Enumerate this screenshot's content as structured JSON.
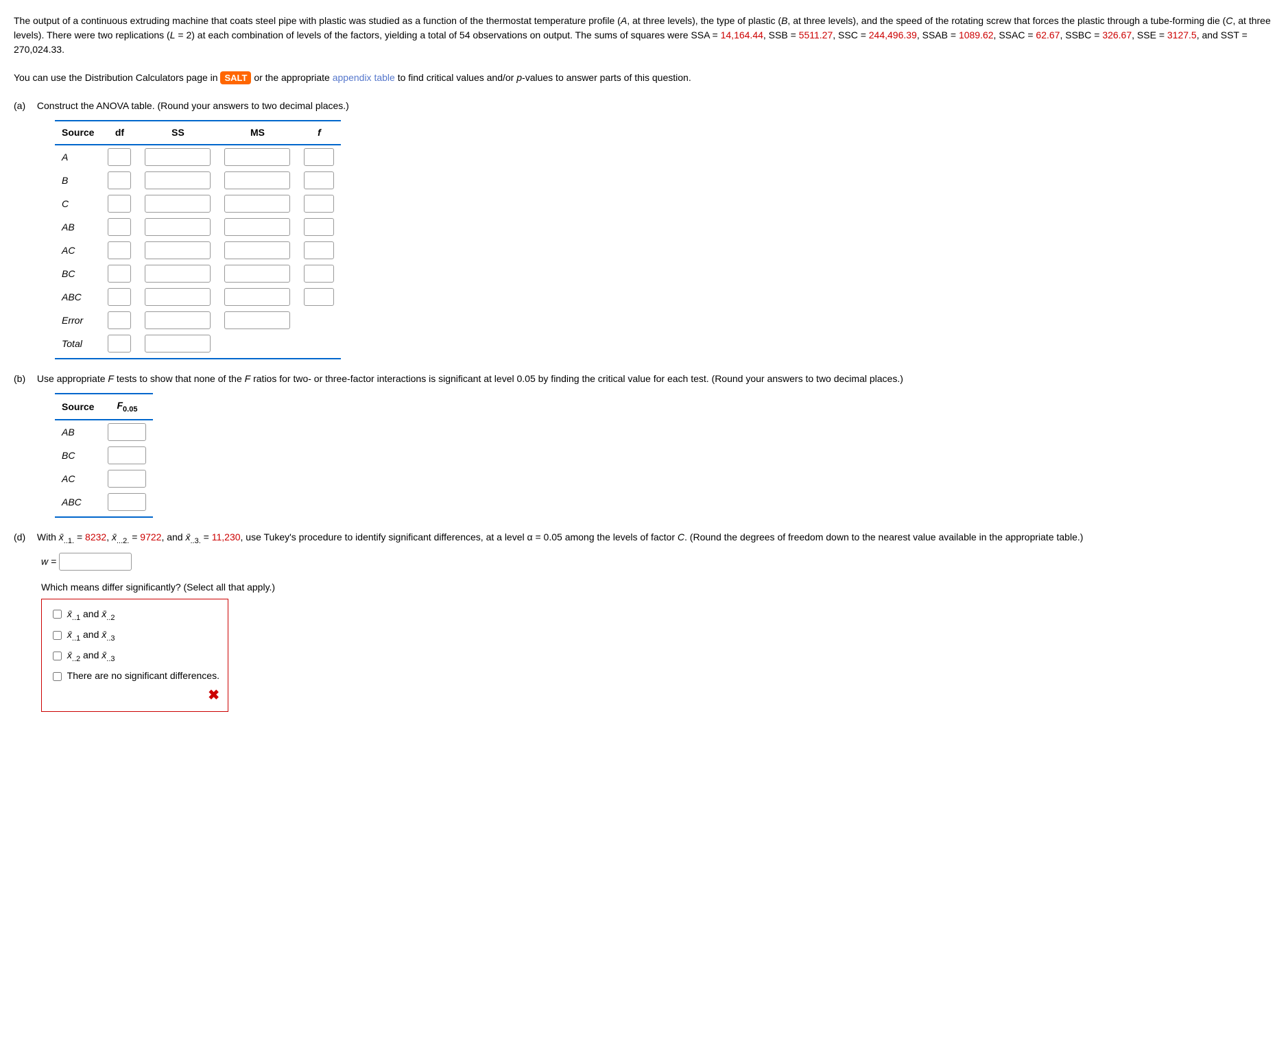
{
  "problem": {
    "p1_a": "The output of a continuous extruding machine that coats steel pipe with plastic was studied as a function of the thermostat temperature profile (",
    "p1_A": "A",
    "p1_b": ", at three levels), the type of plastic (",
    "p1_B": "B",
    "p1_c": ", at three levels), and the speed of the rotating screw that forces the plastic through a tube-forming die (",
    "p1_C": "C",
    "p1_d": ", at three levels). There were two replications (",
    "p1_L": "L",
    "p1_e": " = 2) at each combination of levels of the factors, yielding a total of 54 observations on output. The sums of squares were SSA = ",
    "ssa": "14,164.44",
    "p1_f": ", SSB = ",
    "ssb": "5511.27",
    "p1_g": ", SSC = ",
    "ssc": "244,496.39",
    "p1_h": ", SSAB = ",
    "ssab": "1089.62",
    "p1_i": ", SSAC = ",
    "ssac": "62.67",
    "p1_j": ", SSBC = ",
    "ssbc": "326.67",
    "p1_k": ", SSE = ",
    "sse": "3127.5",
    "p1_l": ", and SST = 270,024.33."
  },
  "salt_line": {
    "pre": "You can use the Distribution Calculators page in ",
    "salt": "SALT",
    "mid": " or the appropriate ",
    "link": "appendix table",
    "post": " to find critical values and/or ",
    "p": "p",
    "post2": "-values to answer parts of this question."
  },
  "partA": {
    "label": "(a)",
    "text": "Construct the ANOVA table. (Round your answers to two decimal places.)",
    "headers": {
      "source": "Source",
      "df": "df",
      "ss": "SS",
      "ms": "MS",
      "f": "f"
    },
    "rows": [
      "A",
      "B",
      "C",
      "AB",
      "AC",
      "BC",
      "ABC",
      "Error",
      "Total"
    ]
  },
  "partB": {
    "label": "(b)",
    "text_a": "Use appropriate ",
    "F1": "F",
    "text_b": " tests to show that none of the ",
    "F2": "F",
    "text_c": " ratios for two- or three-factor interactions is significant at level 0.05 by finding the critical value for each test. (Round your answers to two decimal places.)",
    "headers": {
      "source": "Source",
      "f": "F",
      "fsub": "0.05"
    },
    "rows": [
      "AB",
      "BC",
      "AC",
      "ABC"
    ]
  },
  "partD": {
    "label": "(d)",
    "pre": "With ",
    "x1lbl": "x̄",
    "x1sub": "..1.",
    "eq1": " = ",
    "x1": "8232",
    "x2sub": "...2.",
    "eq2": ", ",
    "x2": "9722",
    "eq3": ", and ",
    "x3sub": "..3.",
    "x3": "11,230",
    "post": ", use Tukey's procedure to identify significant differences, at a level α = 0.05 among the levels of factor ",
    "C": "C",
    "post2": ". (Round the degrees of freedom down to the nearest value available in the appropriate table.)",
    "wlabel": "w = ",
    "which": "Which means differ significantly? (Select all that apply.)",
    "opts": {
      "o1_a": "x̄",
      "o1_asub": "..1",
      "o1_mid": " and ",
      "o1_b": "x̄",
      "o1_bsub": "..2",
      "o2_a": "x̄",
      "o2_asub": "..1",
      "o2_mid": " and ",
      "o2_b": "x̄",
      "o2_bsub": "..3",
      "o3_a": "x̄",
      "o3_asub": "..2",
      "o3_mid": " and ",
      "o3_b": "x̄",
      "o3_bsub": "..3",
      "o4": "There are no significant differences."
    },
    "xicon": "✖"
  }
}
